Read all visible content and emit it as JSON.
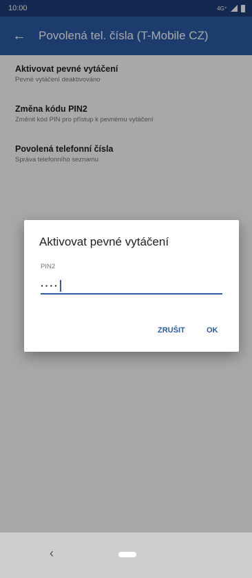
{
  "status_bar": {
    "time": "10:00",
    "network": "4G⁺"
  },
  "app_bar": {
    "title": "Povolená tel. čísla (T-Mobile CZ)"
  },
  "list": [
    {
      "title": "Aktivovat pevné vytáčení",
      "subtitle": "Pevné vytáčení deaktivováno"
    },
    {
      "title": "Změna kódu PIN2",
      "subtitle": "Změnit kód PIN pro přístup k pevnému vytáčení"
    },
    {
      "title": "Povolená telefonní čísla",
      "subtitle": "Správa telefonního seznamu"
    }
  ],
  "dialog": {
    "title": "Aktivovat pevné vytáčení",
    "field_label": "PIN2",
    "field_value": "····",
    "cancel_label": "ZRUŠIT",
    "ok_label": "OK"
  },
  "nav_bar": {
    "back_icon": "‹"
  },
  "colors": {
    "status_bar": "#1e3f7a",
    "app_bar": "#2d5ba8",
    "accent": "#2d5ba8"
  }
}
